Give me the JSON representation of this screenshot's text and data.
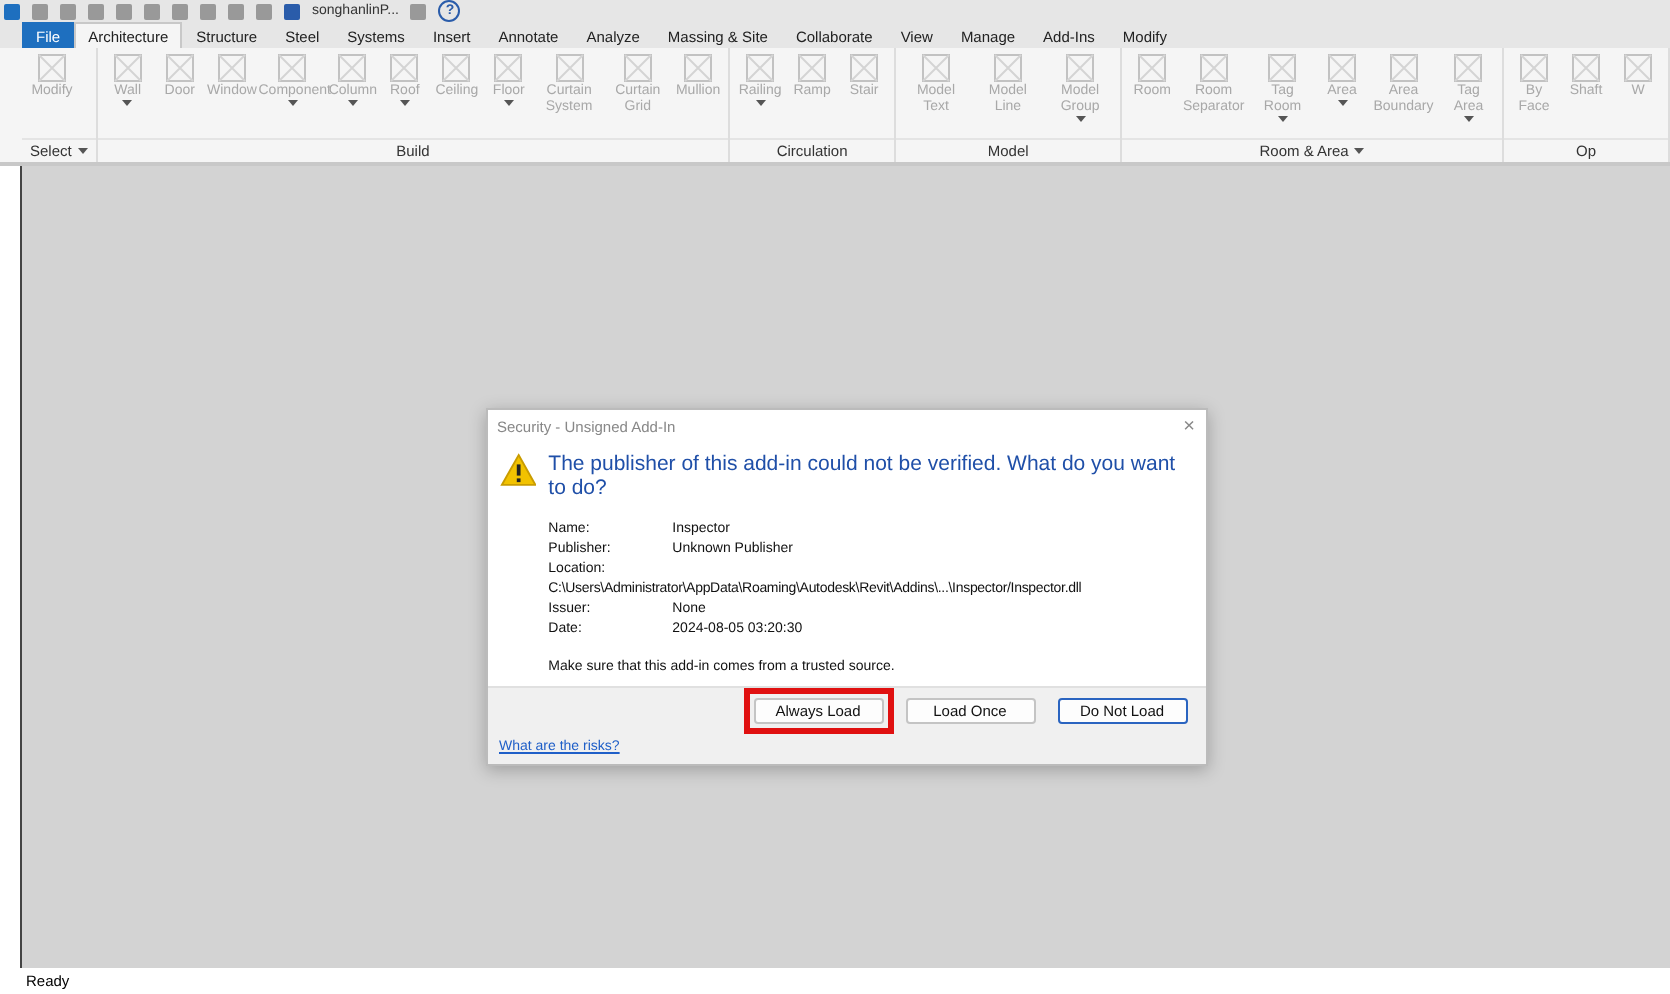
{
  "quick_access": {
    "user": "songhanlinP...",
    "help": "?"
  },
  "tabs": [
    {
      "label": "File",
      "kind": "file",
      "selected": false
    },
    {
      "label": "Architecture",
      "kind": "tab",
      "selected": true
    },
    {
      "label": "Structure",
      "kind": "tab",
      "selected": false
    },
    {
      "label": "Steel",
      "kind": "tab",
      "selected": false
    },
    {
      "label": "Systems",
      "kind": "tab",
      "selected": false
    },
    {
      "label": "Insert",
      "kind": "tab",
      "selected": false
    },
    {
      "label": "Annotate",
      "kind": "tab",
      "selected": false
    },
    {
      "label": "Analyze",
      "kind": "tab",
      "selected": false
    },
    {
      "label": "Massing & Site",
      "kind": "tab",
      "selected": false
    },
    {
      "label": "Collaborate",
      "kind": "tab",
      "selected": false
    },
    {
      "label": "View",
      "kind": "tab",
      "selected": false
    },
    {
      "label": "Manage",
      "kind": "tab",
      "selected": false
    },
    {
      "label": "Add-Ins",
      "kind": "tab",
      "selected": false
    },
    {
      "label": "Modify",
      "kind": "tab",
      "selected": false
    }
  ],
  "ribbon": {
    "disabled": true,
    "panels": [
      {
        "label": "Select",
        "menu": true,
        "tools": [
          {
            "label": "Modify",
            "dropdown": false
          }
        ]
      },
      {
        "label": "Build",
        "menu": false,
        "tools": [
          {
            "label": "Wall",
            "dropdown": true
          },
          {
            "label": "Door",
            "dropdown": false
          },
          {
            "label": "Window",
            "dropdown": false
          },
          {
            "label": "Component",
            "dropdown": true
          },
          {
            "label": "Column",
            "dropdown": true
          },
          {
            "label": "Roof",
            "dropdown": true
          },
          {
            "label": "Ceiling",
            "dropdown": false
          },
          {
            "label": "Floor",
            "dropdown": true
          },
          {
            "label": "Curtain System",
            "dropdown": false
          },
          {
            "label": "Curtain Grid",
            "dropdown": false
          },
          {
            "label": "Mullion",
            "dropdown": false
          }
        ]
      },
      {
        "label": "Circulation",
        "menu": false,
        "tools": [
          {
            "label": "Railing",
            "dropdown": true
          },
          {
            "label": "Ramp",
            "dropdown": false
          },
          {
            "label": "Stair",
            "dropdown": false
          }
        ]
      },
      {
        "label": "Model",
        "menu": false,
        "tools": [
          {
            "label": "Model Text",
            "dropdown": false
          },
          {
            "label": "Model Line",
            "dropdown": false
          },
          {
            "label": "Model Group",
            "dropdown": true
          }
        ]
      },
      {
        "label": "Room & Area",
        "menu": true,
        "tools": [
          {
            "label": "Room",
            "dropdown": false
          },
          {
            "label": "Room Separator",
            "dropdown": false
          },
          {
            "label": "Tag Room",
            "dropdown": true
          },
          {
            "label": "Area",
            "dropdown": true
          },
          {
            "label": "Area Boundary",
            "dropdown": false
          },
          {
            "label": "Tag Area",
            "dropdown": true
          }
        ]
      },
      {
        "label": "Op",
        "menu": false,
        "tools": [
          {
            "label": "By Face",
            "dropdown": false
          },
          {
            "label": "Shaft",
            "dropdown": false
          },
          {
            "label": "W",
            "dropdown": false
          }
        ]
      }
    ]
  },
  "dialog": {
    "title": "Security - Unsigned Add-In",
    "close": "×",
    "heading": "The publisher of this add-in could not be verified. What do you want to do?",
    "details": [
      {
        "label": "Name:",
        "value": "Inspector",
        "kind": "inline"
      },
      {
        "label": "Publisher:",
        "value": "Unknown Publisher",
        "kind": "inline"
      },
      {
        "label": "Location:",
        "value": "C:\\Users\\Administrator\\AppData\\Roaming\\Autodesk\\Revit\\Addins\\...\\Inspector/Inspector.dll",
        "kind": "below"
      },
      {
        "label": "Issuer:",
        "value": "None",
        "kind": "inline"
      },
      {
        "label": "Date:",
        "value": "2024-08-05 03:20:30",
        "kind": "inline"
      }
    ],
    "note": "Make sure that this add-in comes from a trusted source.",
    "buttons": [
      {
        "label": "Always Load",
        "default": false,
        "highlighted": true
      },
      {
        "label": "Load Once",
        "default": false,
        "highlighted": false
      },
      {
        "label": "Do Not Load",
        "default": true,
        "highlighted": false
      }
    ],
    "link": "What are the risks?"
  },
  "status_bar": {
    "text": "Ready"
  }
}
